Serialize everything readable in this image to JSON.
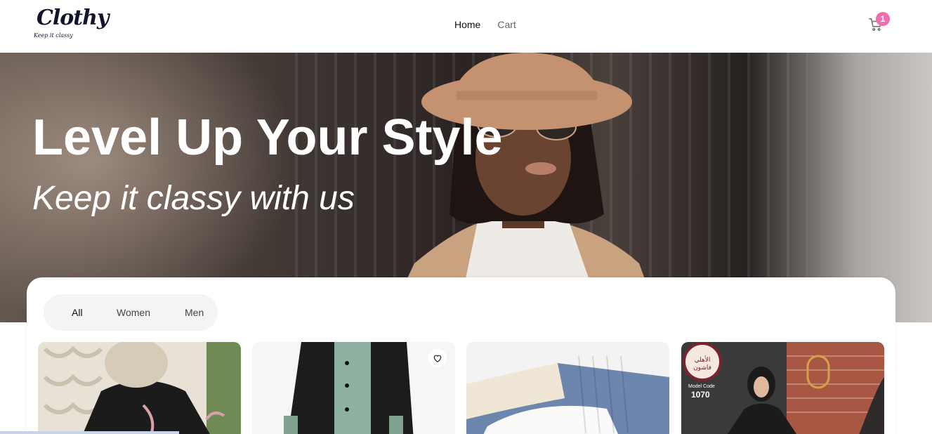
{
  "brand": {
    "name": "Clothy",
    "tagline": "Keep it classy"
  },
  "nav": {
    "home": "Home",
    "cart": "Cart"
  },
  "cart": {
    "count": "1"
  },
  "hero": {
    "title": "Level Up Your Style",
    "subtitle": "Keep it classy with us"
  },
  "filters": [
    "All",
    "Women",
    "Men"
  ],
  "products": [
    {
      "image": "woman in black embroidered abaya",
      "favorite_icon": false
    },
    {
      "image": "black and sage green abaya",
      "favorite_icon": "heart-icon"
    },
    {
      "image": "ribbed knit turtleneck sweaters",
      "favorite_icon": false
    },
    {
      "image": "abaya model with brand logo",
      "badge_text": "الأهلي فاشون",
      "model_label": "Model Code",
      "model_code": "1070"
    }
  ],
  "colors": {
    "accent": "#ef6fae",
    "text": "#111111",
    "muted": "#666666"
  }
}
